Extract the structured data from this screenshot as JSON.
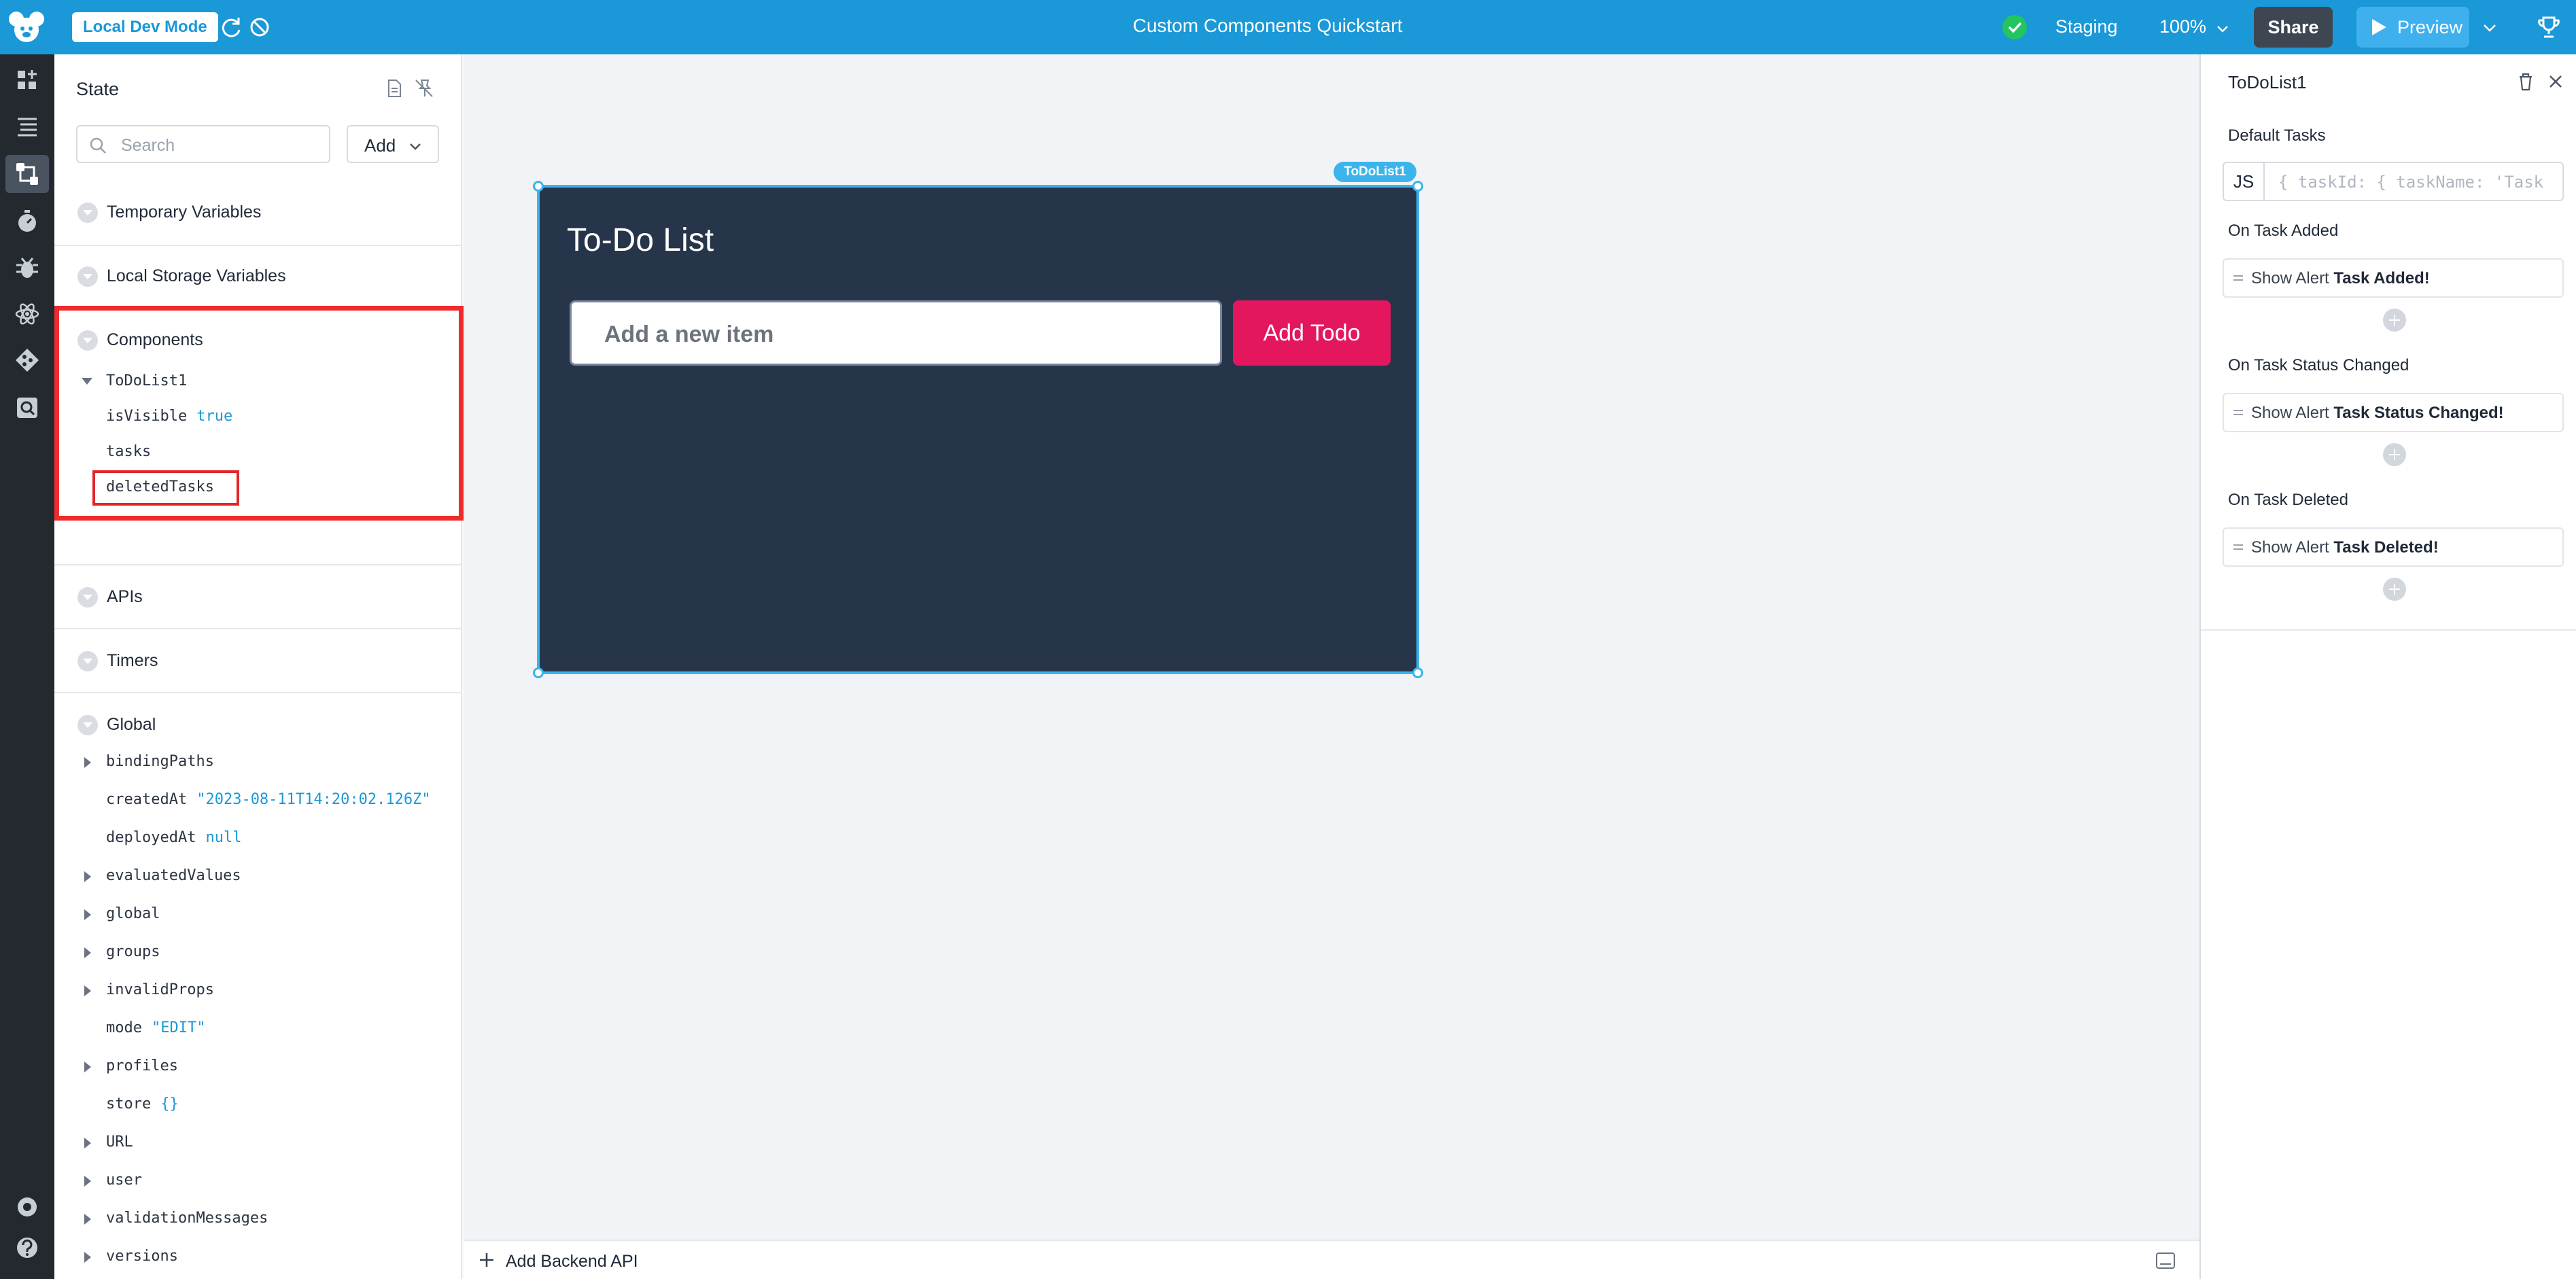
{
  "topbar": {
    "mode_label": "Local Dev Mode",
    "app_title": "Custom Components Quickstart",
    "environment": "Staging",
    "zoom": "100%",
    "share_label": "Share",
    "preview_label": "Preview"
  },
  "state_panel": {
    "title": "State",
    "search_placeholder": "Search",
    "add_label": "Add",
    "sections": {
      "temporary": "Temporary Variables",
      "local_storage": "Local Storage Variables",
      "components": "Components",
      "apis": "APIs",
      "timers": "Timers",
      "global": "Global"
    },
    "component_tree": {
      "name": "ToDoList1",
      "props": [
        {
          "key": "isVisible",
          "value": "true"
        },
        {
          "key": "tasks",
          "value": ""
        },
        {
          "key": "deletedTasks",
          "value": ""
        }
      ]
    },
    "global_tree": [
      {
        "key": "bindingPaths",
        "value": "",
        "expandable": true
      },
      {
        "key": "createdAt",
        "value": "\"2023-08-11T14:20:02.126Z\"",
        "expandable": false
      },
      {
        "key": "deployedAt",
        "value": "null",
        "expandable": false
      },
      {
        "key": "evaluatedValues",
        "value": "",
        "expandable": true
      },
      {
        "key": "global",
        "value": "",
        "expandable": true
      },
      {
        "key": "groups",
        "value": "",
        "expandable": true
      },
      {
        "key": "invalidProps",
        "value": "",
        "expandable": true
      },
      {
        "key": "mode",
        "value": "\"EDIT\"",
        "expandable": false
      },
      {
        "key": "profiles",
        "value": "",
        "expandable": true
      },
      {
        "key": "store",
        "value": "{}",
        "expandable": false
      },
      {
        "key": "URL",
        "value": "",
        "expandable": true
      },
      {
        "key": "user",
        "value": "",
        "expandable": true
      },
      {
        "key": "validationMessages",
        "value": "",
        "expandable": true
      },
      {
        "key": "versions",
        "value": "",
        "expandable": true
      }
    ]
  },
  "canvas": {
    "widget_tag": "ToDoList1",
    "todo_title": "To-Do List",
    "input_placeholder": "Add a new item",
    "add_button": "Add Todo"
  },
  "bottom_bar": {
    "add_backend_label": "Add Backend API"
  },
  "right_panel": {
    "title": "ToDoList1",
    "default_tasks_label": "Default Tasks",
    "js_label": "JS",
    "default_tasks_code": "{ taskId: { taskName: 'Task",
    "events": [
      {
        "label": "On Task Added",
        "action": "Show Alert",
        "message": "Task Added!"
      },
      {
        "label": "On Task Status Changed",
        "action": "Show Alert",
        "message": "Task Status Changed!"
      },
      {
        "label": "On Task Deleted",
        "action": "Show Alert",
        "message": "Task Deleted!"
      }
    ]
  },
  "colors": {
    "topbar": "#1a98d7",
    "rail": "#24292f",
    "todo_bg": "#27354b",
    "todo_button": "#e3165e",
    "highlight": "#ef2b2b",
    "selection": "#3bb4ec"
  }
}
